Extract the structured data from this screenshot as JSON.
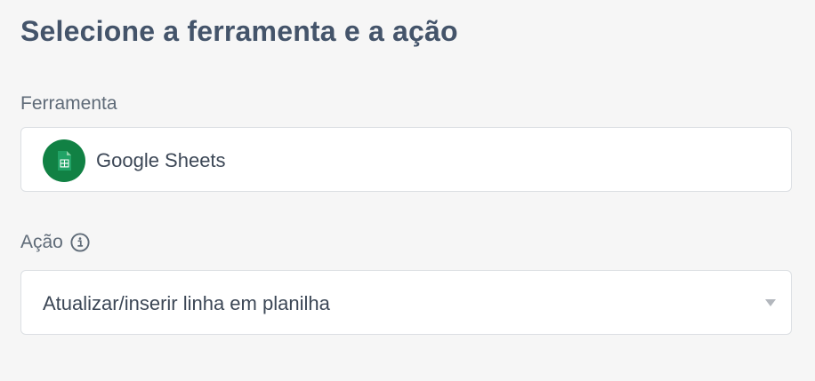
{
  "header": {
    "title": "Selecione a ferramenta e a ação"
  },
  "tool_field": {
    "label": "Ferramenta",
    "value": "Google Sheets",
    "logo_icon": "google-sheets-icon",
    "logo_color": "#118144"
  },
  "action_field": {
    "label": "Ação",
    "label_icon": "info-icon",
    "value": "Atualizar/inserir linha em planilha",
    "dropdown_icon": "chevron-down-icon"
  }
}
